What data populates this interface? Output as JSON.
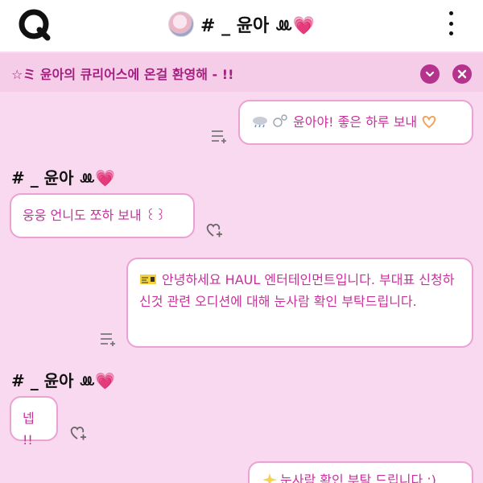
{
  "header": {
    "title": "# _ 윤아 ꔛ💗"
  },
  "notice": {
    "text": "☆ミ 윤아의 큐리어스에 온걸 환영해 - !!"
  },
  "messages": [
    {
      "side": "right",
      "text": "윤아야! 좋은 하루 보내"
    },
    {
      "side": "left",
      "sender": "# _ 윤아 ꔛ💗",
      "text": "웅웅 언니도 쪼하 보내 ꒰꒱"
    },
    {
      "side": "right",
      "text": "안녕하세요 HAUL 엔터테인먼트입니다. 부대표 신청하신것 관련 오디션에 대해 눈사람 확인 부탁드립니다."
    },
    {
      "side": "left",
      "sender": "# _ 윤아 ꔛ💗",
      "text": "넵 !!"
    },
    {
      "side": "right",
      "text": "눈사람 확인 부탁 드립니다 :)"
    }
  ],
  "icons": {
    "logo": "curious-logo-icon",
    "more": "kebab-menu-icon",
    "collapse": "chevron-down-icon",
    "close": "close-icon",
    "reply": "reply-menu-icon",
    "like": "heart-plus-icon"
  },
  "colors": {
    "background": "#f9d9ef",
    "accent": "#b5338c",
    "bubble_text": "#c9309a",
    "bubble_border": "#eaa2d4"
  }
}
